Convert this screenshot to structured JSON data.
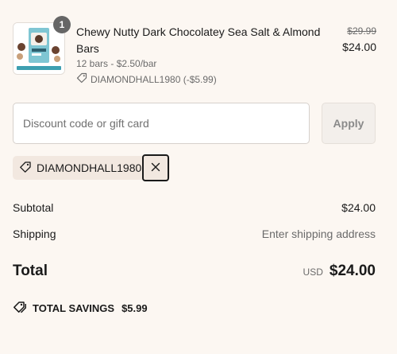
{
  "product": {
    "quantity": "1",
    "title": "Chewy Nutty Dark Chocolatey Sea Salt & Almond Bars",
    "variant": "12 bars - $2.50/bar",
    "discount_tag": "DIAMONDHALL1980 (-$5.99)",
    "price_original": "$29.99",
    "price_current": "$24.00",
    "thumbnail_icon": "product-image"
  },
  "discount": {
    "placeholder": "Discount code or gift card",
    "value": "",
    "apply_label": "Apply",
    "applied_code": "DIAMONDHALL1980",
    "tag_icon": "tag-icon",
    "remove_icon": "close-icon"
  },
  "summary": {
    "subtotal_label": "Subtotal",
    "subtotal_value": "$24.00",
    "shipping_label": "Shipping",
    "shipping_value": "Enter shipping address",
    "total_label": "Total",
    "currency": "USD",
    "total_value": "$24.00",
    "savings_label": "TOTAL SAVINGS",
    "savings_value": "$5.99"
  },
  "colors": {
    "background": "#fcf7f2",
    "chip_background": "#f2e8e0",
    "muted_text": "#6b6b6b"
  }
}
